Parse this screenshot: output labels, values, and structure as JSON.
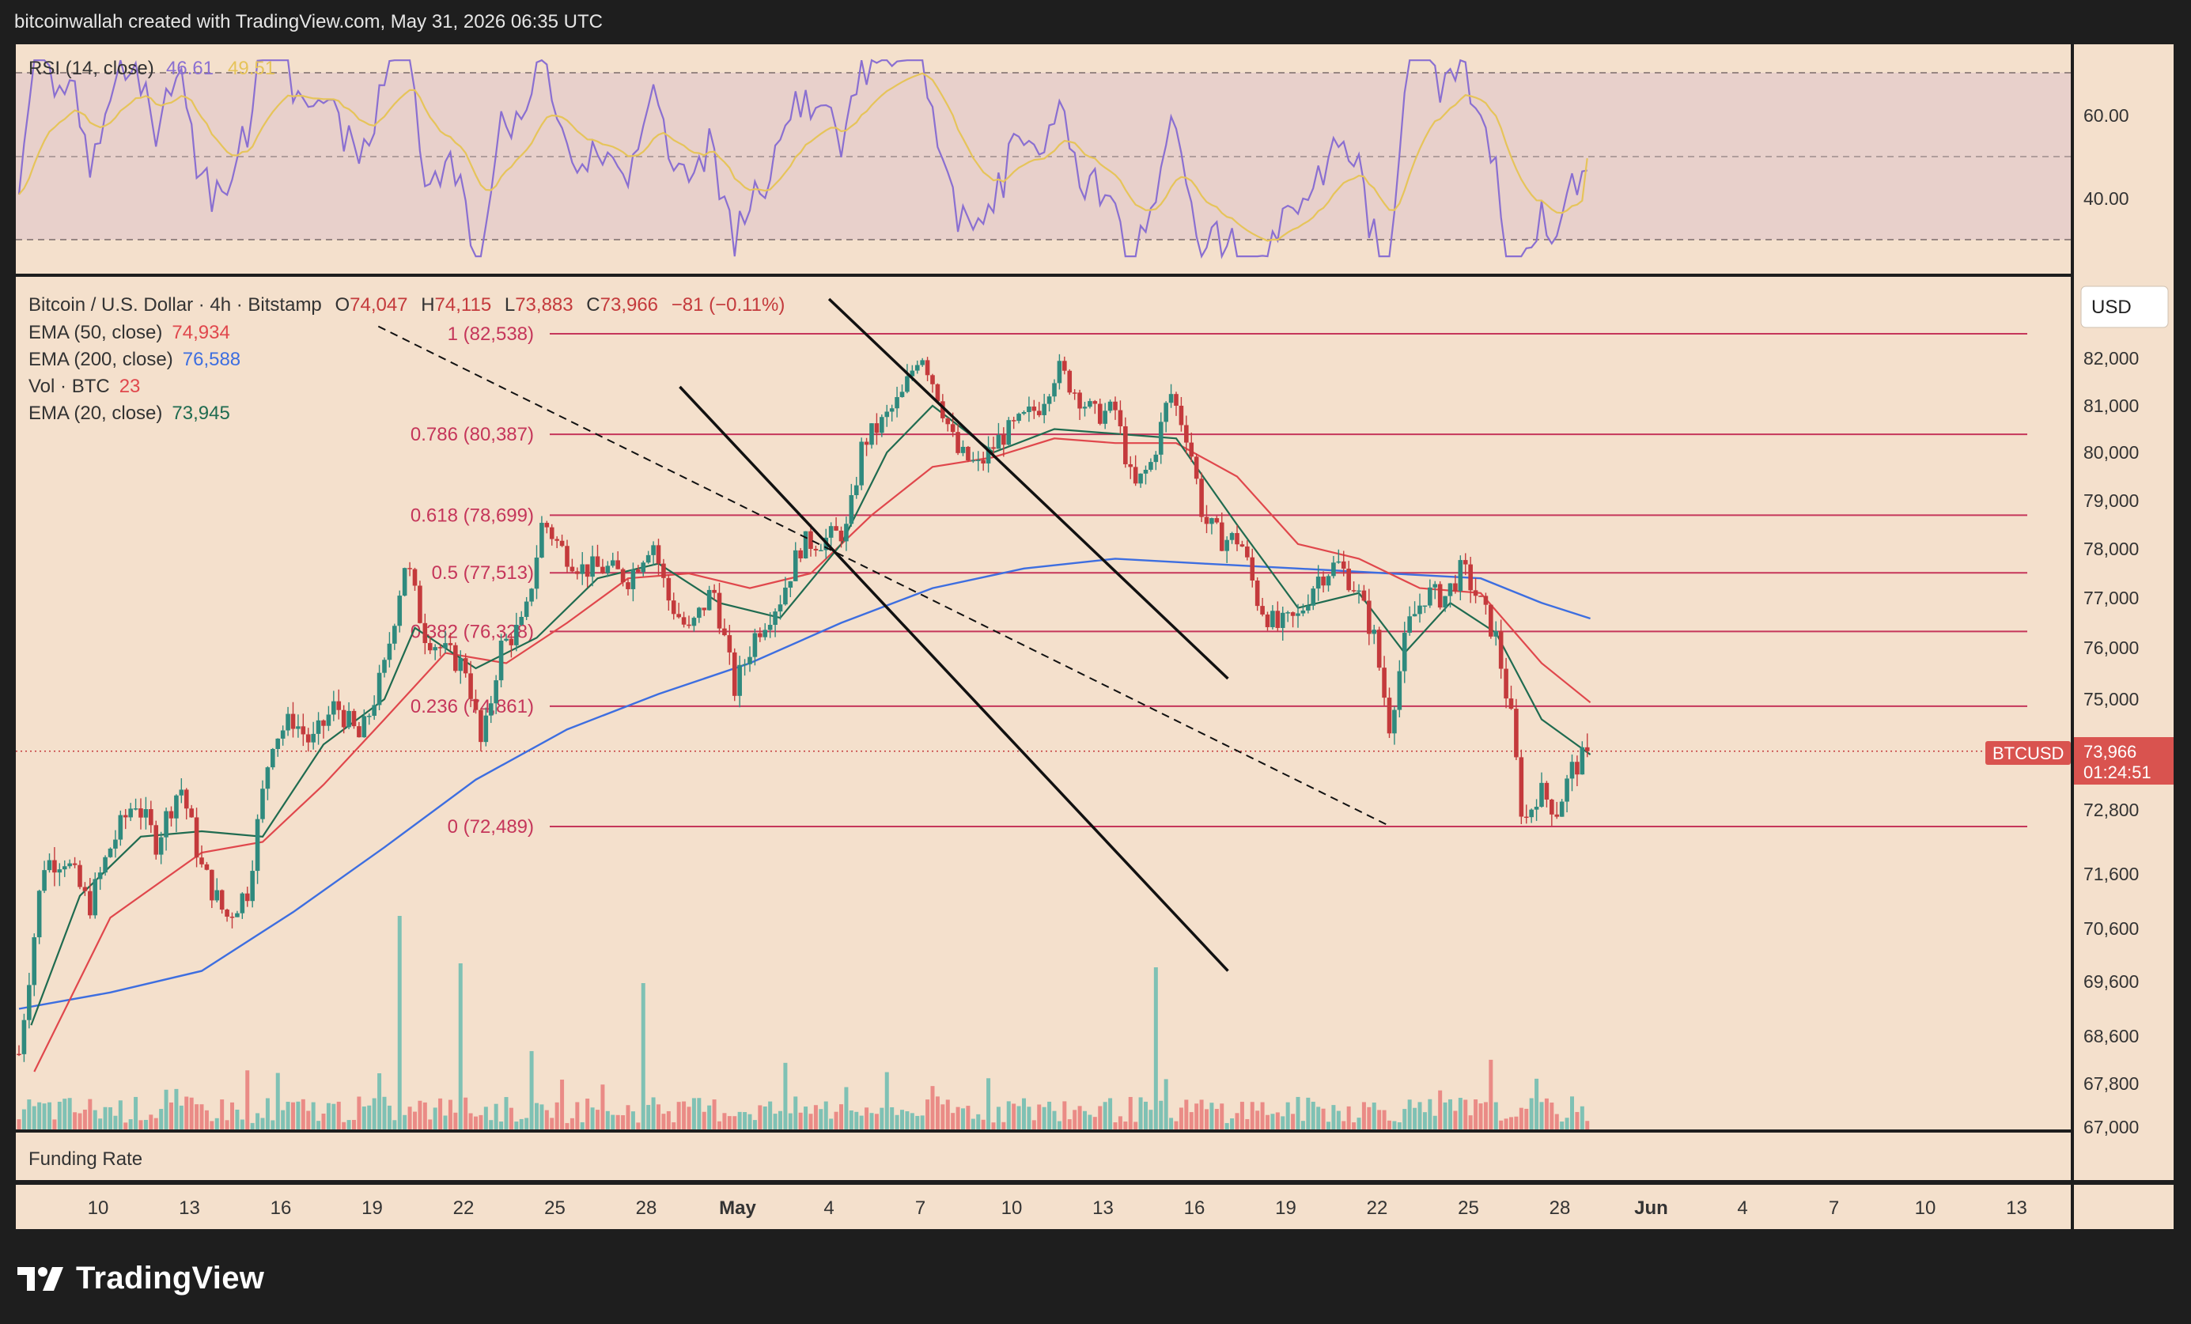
{
  "header": {
    "credit": "bitcoinwallah created with TradingView.com, May 31, 2026 06:35 UTC"
  },
  "footer": {
    "brand": "TradingView",
    "logo_icon": "tradingview-logo-icon"
  },
  "colors": {
    "background": "#f4e0cc",
    "up": "#2f8a7e",
    "down": "#c43a3c",
    "fib": "#c5365a",
    "ema50": "#e0474c",
    "ema200": "#3d6ee0",
    "ema20": "#1f6b50",
    "rsi": "#8a6fd1",
    "rsi_ma": "#e6c45a",
    "vol_up": "#7fc1b4",
    "vol_down": "#ea8b86",
    "frame": "#1e1e1e",
    "badge": "#d9534f"
  },
  "legend": {
    "symbol": "Bitcoin / U.S. Dollar · 4h · Bitstamp",
    "open_label": "O",
    "open": "74,047",
    "high_label": "H",
    "high": "74,115",
    "low_label": "L",
    "low": "73,883",
    "close_label": "C",
    "close": "73,966",
    "change": "−81 (−0.11%)",
    "indicators": [
      {
        "name": "EMA (50, close)",
        "value": "74,934",
        "color": "#e0474c"
      },
      {
        "name": "EMA (200, close)",
        "value": "76,588",
        "color": "#3d6ee0"
      },
      {
        "name": "Vol · BTC",
        "value": "23",
        "color": "#e0474c"
      },
      {
        "name": "EMA (20, close)",
        "value": "73,945",
        "color": "#1f6b50"
      }
    ]
  },
  "rsi_panel": {
    "label": "RSI (14, close)",
    "value": "46.61",
    "ma_value": "49.51",
    "ticks": [
      "60.00",
      "40.00"
    ],
    "upper_band": 70,
    "mid_band": 50,
    "lower_band": 30
  },
  "funding_panel": {
    "label": "Funding Rate"
  },
  "price_axis": {
    "currency": "USD",
    "ticks": [
      "82,000",
      "81,000",
      "80,000",
      "79,000",
      "78,000",
      "77,000",
      "76,000",
      "75,000",
      "72,800",
      "71,600",
      "70,600",
      "69,600",
      "68,600",
      "67,800",
      "67,000"
    ],
    "badge_symbol": "BTCUSD",
    "badge_price": "73,966",
    "badge_countdown": "01:24:51"
  },
  "time_axis": {
    "labels": [
      "10",
      "13",
      "16",
      "19",
      "22",
      "25",
      "28",
      "May",
      "4",
      "7",
      "10",
      "13",
      "16",
      "19",
      "22",
      "25",
      "28",
      "Jun",
      "4",
      "7",
      "10",
      "13"
    ]
  },
  "fibonacci": [
    {
      "label": "1 (82,538)",
      "level": 82538
    },
    {
      "label": "0.786 (80,387)",
      "level": 80387
    },
    {
      "label": "0.618 (78,699)",
      "level": 78699
    },
    {
      "label": "0.5 (77,513)",
      "level": 77513
    },
    {
      "label": "0.382 (76,328)",
      "level": 76328
    },
    {
      "label": "0.236 (74,861)",
      "level": 74861
    },
    {
      "label": "0 (72,489)",
      "level": 72489
    }
  ],
  "chart_data": {
    "type": "candlestick",
    "interval": "4h",
    "x_range": [
      "Apr 8",
      "Jun 13"
    ],
    "y_range": [
      67000,
      83300
    ],
    "last_price": 73966,
    "anchors": [
      {
        "day": 0,
        "price": 68300
      },
      {
        "day": 0.3,
        "price": 69600
      },
      {
        "day": 0.8,
        "price": 71800
      },
      {
        "day": 1.5,
        "price": 71900
      },
      {
        "day": 2.3,
        "price": 71000
      },
      {
        "day": 3.0,
        "price": 72100
      },
      {
        "day": 3.8,
        "price": 73000
      },
      {
        "day": 4.5,
        "price": 72200
      },
      {
        "day": 5.3,
        "price": 73300
      },
      {
        "day": 6.0,
        "price": 71700
      },
      {
        "day": 6.8,
        "price": 70800
      },
      {
        "day": 7.5,
        "price": 71300
      },
      {
        "day": 8.3,
        "price": 74200
      },
      {
        "day": 9.0,
        "price": 74600
      },
      {
        "day": 9.6,
        "price": 74100
      },
      {
        "day": 10.4,
        "price": 74900
      },
      {
        "day": 11.2,
        "price": 74200
      },
      {
        "day": 12.0,
        "price": 75600
      },
      {
        "day": 12.7,
        "price": 77800
      },
      {
        "day": 13.3,
        "price": 76300
      },
      {
        "day": 14.0,
        "price": 75900
      },
      {
        "day": 14.7,
        "price": 75600
      },
      {
        "day": 15.2,
        "price": 74000
      },
      {
        "day": 15.8,
        "price": 76000
      },
      {
        "day": 16.6,
        "price": 76500
      },
      {
        "day": 17.2,
        "price": 78600
      },
      {
        "day": 17.8,
        "price": 78000
      },
      {
        "day": 18.5,
        "price": 77600
      },
      {
        "day": 19.3,
        "price": 77600
      },
      {
        "day": 20.0,
        "price": 77400
      },
      {
        "day": 20.8,
        "price": 78200
      },
      {
        "day": 21.3,
        "price": 77000
      },
      {
        "day": 22.0,
        "price": 76300
      },
      {
        "day": 22.8,
        "price": 77200
      },
      {
        "day": 23.5,
        "price": 75200
      },
      {
        "day": 24.2,
        "price": 76300
      },
      {
        "day": 25.0,
        "price": 77000
      },
      {
        "day": 25.7,
        "price": 78100
      },
      {
        "day": 26.5,
        "price": 78200
      },
      {
        "day": 27.2,
        "price": 78400
      },
      {
        "day": 27.7,
        "price": 80200
      },
      {
        "day": 28.3,
        "price": 80600
      },
      {
        "day": 29.0,
        "price": 81200
      },
      {
        "day": 29.6,
        "price": 82200
      },
      {
        "day": 30.2,
        "price": 81200
      },
      {
        "day": 30.8,
        "price": 80000
      },
      {
        "day": 31.5,
        "price": 79700
      },
      {
        "day": 32.2,
        "price": 80300
      },
      {
        "day": 32.8,
        "price": 80600
      },
      {
        "day": 33.5,
        "price": 81000
      },
      {
        "day": 34.1,
        "price": 81800
      },
      {
        "day": 34.7,
        "price": 81300
      },
      {
        "day": 35.3,
        "price": 80800
      },
      {
        "day": 36.0,
        "price": 80900
      },
      {
        "day": 36.6,
        "price": 79200
      },
      {
        "day": 37.2,
        "price": 79800
      },
      {
        "day": 37.8,
        "price": 81300
      },
      {
        "day": 38.4,
        "price": 80300
      },
      {
        "day": 38.9,
        "price": 78600
      },
      {
        "day": 39.5,
        "price": 78200
      },
      {
        "day": 40.1,
        "price": 78200
      },
      {
        "day": 40.7,
        "price": 76900
      },
      {
        "day": 41.3,
        "price": 76400
      },
      {
        "day": 42.0,
        "price": 76600
      },
      {
        "day": 42.6,
        "price": 77400
      },
      {
        "day": 43.3,
        "price": 77700
      },
      {
        "day": 43.9,
        "price": 77200
      },
      {
        "day": 44.5,
        "price": 76200
      },
      {
        "day": 45.0,
        "price": 74500
      },
      {
        "day": 45.6,
        "price": 76400
      },
      {
        "day": 46.2,
        "price": 77100
      },
      {
        "day": 46.8,
        "price": 77000
      },
      {
        "day": 47.4,
        "price": 77600
      },
      {
        "day": 47.9,
        "price": 77000
      },
      {
        "day": 48.5,
        "price": 76200
      },
      {
        "day": 49.0,
        "price": 74600
      },
      {
        "day": 49.4,
        "price": 72500
      },
      {
        "day": 49.9,
        "price": 73200
      },
      {
        "day": 50.5,
        "price": 72800
      },
      {
        "day": 51.0,
        "price": 73600
      },
      {
        "day": 51.6,
        "price": 73966
      }
    ],
    "ema20_points": [
      [
        0.4,
        68800
      ],
      [
        2,
        71200
      ],
      [
        4,
        72300
      ],
      [
        6,
        72400
      ],
      [
        8,
        72300
      ],
      [
        10,
        74100
      ],
      [
        12,
        75000
      ],
      [
        13,
        76400
      ],
      [
        15,
        75600
      ],
      [
        17,
        76200
      ],
      [
        19,
        77400
      ],
      [
        21,
        77700
      ],
      [
        23,
        76900
      ],
      [
        25,
        76600
      ],
      [
        27,
        78100
      ],
      [
        28.5,
        80000
      ],
      [
        30,
        81000
      ],
      [
        32,
        80000
      ],
      [
        34,
        80500
      ],
      [
        36,
        80400
      ],
      [
        38,
        80300
      ],
      [
        40,
        78500
      ],
      [
        42,
        76800
      ],
      [
        44,
        77100
      ],
      [
        45.5,
        75900
      ],
      [
        47,
        76900
      ],
      [
        48.5,
        76300
      ],
      [
        50,
        74600
      ],
      [
        51.6,
        73900
      ]
    ],
    "ema50_points": [
      [
        0.5,
        68000
      ],
      [
        3,
        70800
      ],
      [
        6,
        72000
      ],
      [
        8,
        72200
      ],
      [
        10,
        73300
      ],
      [
        12,
        74600
      ],
      [
        14,
        75900
      ],
      [
        16,
        75700
      ],
      [
        18,
        76500
      ],
      [
        20,
        77400
      ],
      [
        22,
        77500
      ],
      [
        24,
        77200
      ],
      [
        26,
        77500
      ],
      [
        28,
        78700
      ],
      [
        30,
        79700
      ],
      [
        32,
        79900
      ],
      [
        34,
        80300
      ],
      [
        36,
        80200
      ],
      [
        38,
        80200
      ],
      [
        40,
        79500
      ],
      [
        42,
        78100
      ],
      [
        44,
        77800
      ],
      [
        46,
        77200
      ],
      [
        48,
        77100
      ],
      [
        50,
        75700
      ],
      [
        51.6,
        74934
      ]
    ],
    "ema200_points": [
      [
        0,
        69100
      ],
      [
        3,
        69400
      ],
      [
        6,
        69800
      ],
      [
        9,
        70900
      ],
      [
        12,
        72100
      ],
      [
        15,
        73400
      ],
      [
        18,
        74400
      ],
      [
        21,
        75100
      ],
      [
        24,
        75700
      ],
      [
        27,
        76500
      ],
      [
        30,
        77200
      ],
      [
        33,
        77600
      ],
      [
        36,
        77800
      ],
      [
        38.9,
        77700
      ],
      [
        42,
        77600
      ],
      [
        45,
        77500
      ],
      [
        48,
        77400
      ],
      [
        50,
        76900
      ],
      [
        51.6,
        76588
      ]
    ],
    "channel_upper": [
      [
        26.6,
        83300
      ],
      [
        39.7,
        75400
      ]
    ],
    "channel_lower": [
      [
        21.7,
        81400
      ],
      [
        39.7,
        69800
      ]
    ],
    "dashed_trendline": [
      [
        11.8,
        82700
      ],
      [
        45.0,
        72500
      ]
    ],
    "rsi_value": 46.61,
    "rsi_ma_value": 49.51
  }
}
